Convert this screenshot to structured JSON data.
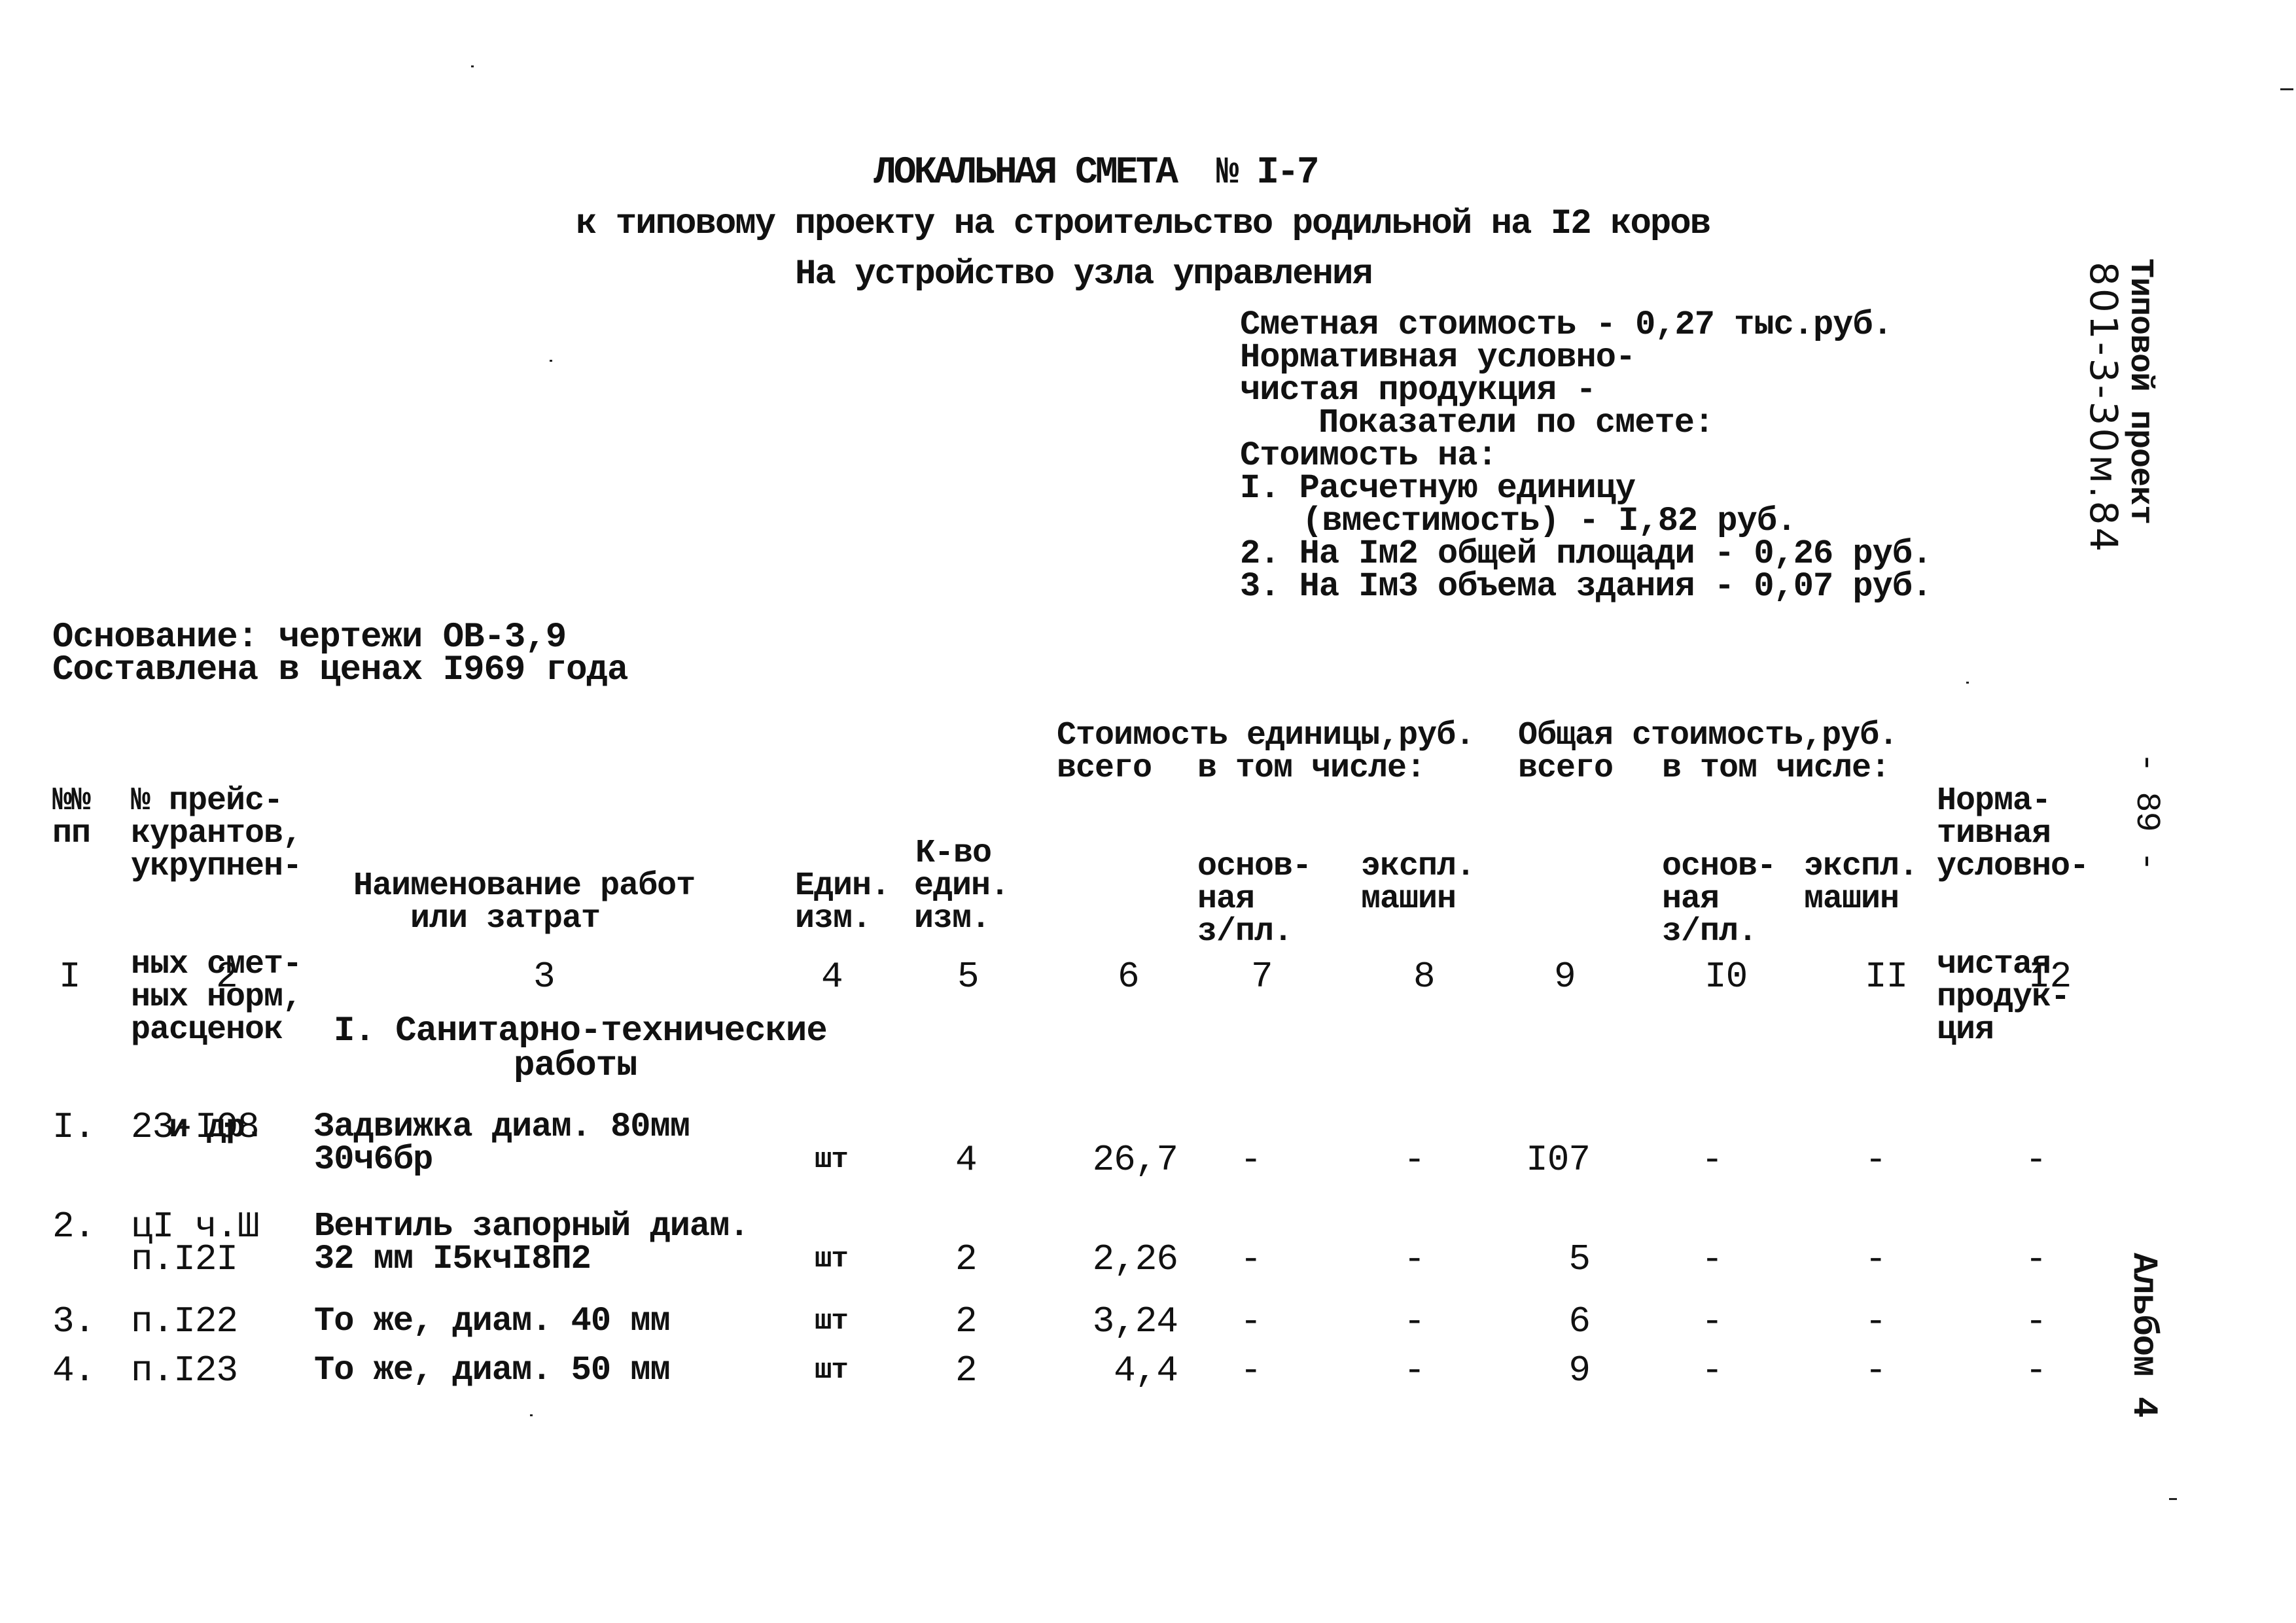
{
  "document": {
    "title": "ЛОКАЛЬНАЯ СМЕТА  № I-7",
    "subtitle": "к типовому проекту на строительство родильной на I2 коров",
    "purpose": "На устройство узла управления",
    "summary": {
      "estimated_cost": "Сметная стоимость - 0,27 тыс.руб.",
      "normative_line1": "Нормативная условно-",
      "normative_line2": "чистая продукция -",
      "indicators_title": "Показатели по смете:",
      "cost_on": "Стоимость на:",
      "item1_line1": "I. Расчетную единицу",
      "item1_line2": "(вместимость) - I,82 руб.",
      "item2": "2. На Iм2 общей площади - 0,26 руб.",
      "item3": "3. На Iм3 объема здания - 0,07 руб."
    },
    "basis": "Основание: чертежи ОВ-3,9",
    "prices": "Составлена в ценах I969 года",
    "side_stamp": {
      "typed": "Типовой проект",
      "handwritten": "801-3-30м.84"
    },
    "page_number": "- 89 -",
    "album": "Альбом 4"
  },
  "table": {
    "headers": {
      "c1": [
        "№№",
        "пп"
      ],
      "c2": [
        "№ прейс-",
        "курантов,",
        "укрупнен-",
        "ных смет-",
        "ных норм,",
        "расценок",
        "  и др."
      ],
      "c3": [
        "Наименование работ",
        "   или затрат"
      ],
      "c4": [
        "Един.",
        "изм."
      ],
      "c5": [
        "К-во",
        "един.",
        "изм."
      ],
      "unit_cost_group": "Стоимость единицы,руб.",
      "c6": "всего",
      "incl_unit": "в том числе:",
      "c7": [
        "основ-",
        "ная",
        "з/пл."
      ],
      "c8": [
        "экспл.",
        "машин"
      ],
      "total_cost_group": "Общая стоимость,руб.",
      "c9": "всего",
      "incl_total": "в том числе:",
      "c10": [
        "основ-",
        "ная",
        "з/пл."
      ],
      "c11": [
        "экспл.",
        "машин"
      ],
      "c12": [
        "Норма-",
        "тивная",
        "условно-",
        "чистая",
        "продук-",
        "ция"
      ]
    },
    "column_numbers": [
      "I",
      "2",
      "3",
      "4",
      "5",
      "6",
      "7",
      "8",
      "9",
      "I0",
      "II",
      "I2"
    ],
    "section": {
      "line1": "I. Санитарно-технические",
      "line2": "работы"
    },
    "rows": [
      {
        "no": "I.",
        "code": [
          "23-I08"
        ],
        "name": [
          "Задвижка диам. 80мм",
          "30ч6бр"
        ],
        "unit": "шт",
        "qty": "4",
        "unit_total": "26,7",
        "unit_wage": "-",
        "unit_machine": "-",
        "total": "I07",
        "total_wage": "-",
        "total_machine": "-",
        "normative": "-"
      },
      {
        "no": "2.",
        "code": [
          "цI ч.Ш",
          "п.I2I"
        ],
        "name": [
          "Вентиль запорный диам.",
          "32 мм I5кчI8П2"
        ],
        "unit": "шт",
        "qty": "2",
        "unit_total": "2,26",
        "unit_wage": "-",
        "unit_machine": "-",
        "total": "5",
        "total_wage": "-",
        "total_machine": "-",
        "normative": "-"
      },
      {
        "no": "3.",
        "code": [
          "п.I22"
        ],
        "name": [
          "То же, диам. 40 мм"
        ],
        "unit": "шт",
        "qty": "2",
        "unit_total": "3,24",
        "unit_wage": "-",
        "unit_machine": "-",
        "total": "6",
        "total_wage": "-",
        "total_machine": "-",
        "normative": "-"
      },
      {
        "no": "4.",
        "code": [
          "п.I23"
        ],
        "name": [
          "То же, диам. 50 мм"
        ],
        "unit": "шт",
        "qty": "2",
        "unit_total": "4,4",
        "unit_wage": "-",
        "unit_machine": "-",
        "total": "9",
        "total_wage": "-",
        "total_machine": "-",
        "normative": "-"
      }
    ]
  }
}
